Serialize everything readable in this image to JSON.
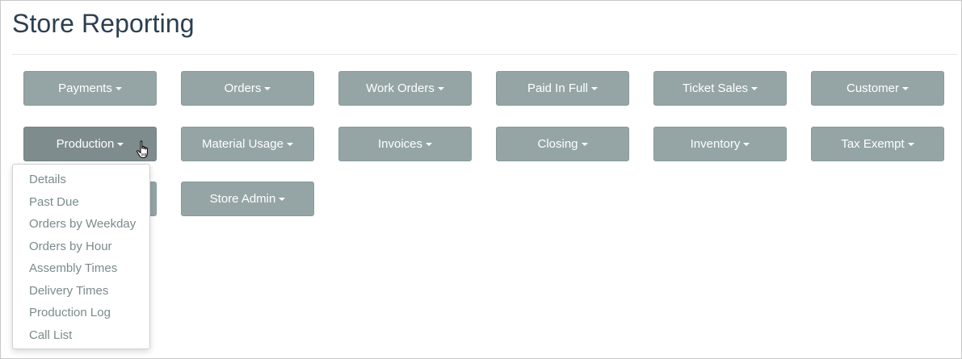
{
  "page": {
    "title": "Store Reporting"
  },
  "buttons": {
    "payments": "Payments",
    "orders": "Orders",
    "work_orders": "Work Orders",
    "paid_in_full": "Paid In Full",
    "ticket_sales": "Ticket Sales",
    "customer": "Customer",
    "production": "Production",
    "material_usage": "Material Usage",
    "invoices": "Invoices",
    "closing": "Closing",
    "inventory": "Inventory",
    "tax_exempt": "Tax Exempt",
    "store_admin": "Store Admin"
  },
  "production_menu": {
    "items": [
      "Details",
      "Past Due",
      "Orders by Weekday",
      "Orders by Hour",
      "Assembly Times",
      "Delivery Times",
      "Production Log",
      "Call List"
    ]
  },
  "colors": {
    "button": "#95a5a6",
    "button_active": "#7f8c8d",
    "title": "#2c3e50",
    "menu_text": "#7b8a8b"
  },
  "icons": {
    "cursor": "hand-pointer-icon",
    "caret": "caret-down-icon"
  }
}
